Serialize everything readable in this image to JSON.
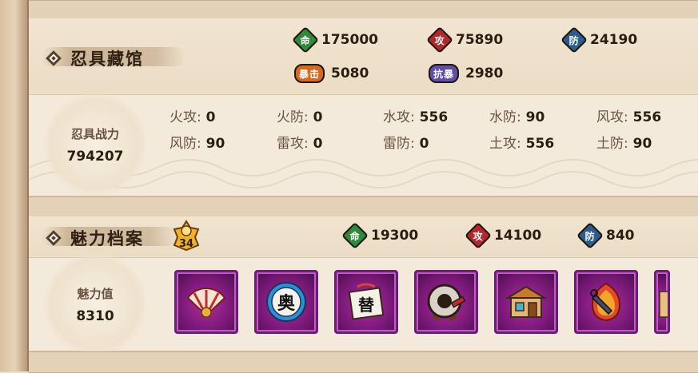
{
  "ninja_tool_hall": {
    "title": "忍具藏馆",
    "stats": [
      {
        "badge": "命",
        "color": "#2f8a3a",
        "value": "175000"
      },
      {
        "badge": "攻",
        "color": "#b3262a",
        "value": "75890"
      },
      {
        "badge": "防",
        "color": "#2b5c8e",
        "value": "24190"
      },
      {
        "badge": "暴击",
        "color": "#d46a1f",
        "value": "5080"
      },
      {
        "badge": "抗暴",
        "color": "#5d4fa3",
        "value": "2980"
      }
    ],
    "power_label": "忍具战力",
    "power_value": "794207",
    "attributes": [
      {
        "label": "火攻:",
        "value": "0"
      },
      {
        "label": "火防:",
        "value": "0"
      },
      {
        "label": "水攻:",
        "value": "556"
      },
      {
        "label": "水防:",
        "value": "90"
      },
      {
        "label": "风攻:",
        "value": "556"
      },
      {
        "label": "风防:",
        "value": "90"
      },
      {
        "label": "雷攻:",
        "value": "0"
      },
      {
        "label": "雷防:",
        "value": "0"
      },
      {
        "label": "土攻:",
        "value": "556"
      },
      {
        "label": "土防:",
        "value": "90"
      }
    ]
  },
  "charm_archive": {
    "title": "魅力档案",
    "level": "34",
    "stats": [
      {
        "badge": "命",
        "color": "#2f8a3a",
        "value": "19300"
      },
      {
        "badge": "攻",
        "color": "#b3262a",
        "value": "14100"
      },
      {
        "badge": "防",
        "color": "#2b5c8e",
        "value": "840"
      }
    ],
    "charm_label": "魅力值",
    "charm_value": "8310",
    "items": [
      {
        "icon": "fan-icon"
      },
      {
        "icon": "ougi-scroll-icon",
        "glyph": "奥"
      },
      {
        "icon": "substitution-scroll-icon",
        "glyph": "替"
      },
      {
        "icon": "drum-icon"
      },
      {
        "icon": "shop-building-icon"
      },
      {
        "icon": "kunai-flame-icon"
      },
      {
        "icon": "partial-item-icon"
      }
    ]
  }
}
